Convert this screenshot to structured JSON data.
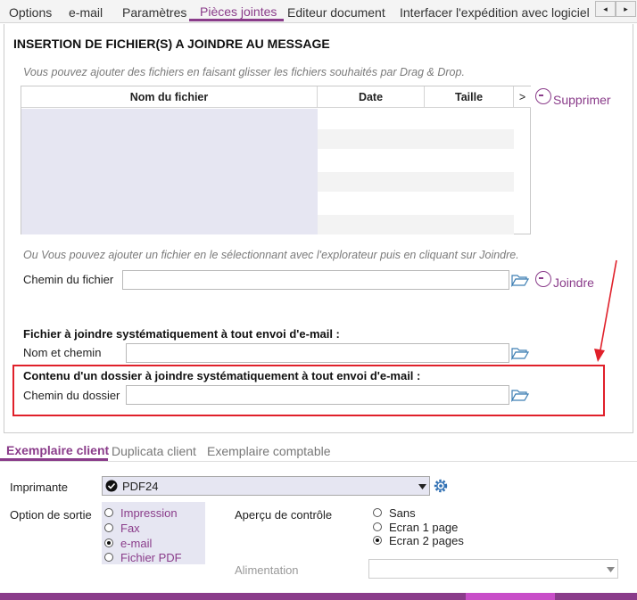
{
  "top_tabs": [
    {
      "label": "Options"
    },
    {
      "label": "e-mail"
    },
    {
      "label": "Paramètres"
    },
    {
      "label": "Pièces jointes"
    },
    {
      "label": "Editeur document"
    },
    {
      "label": "Interfacer l'expédition avec logiciel"
    }
  ],
  "nav": {
    "prev": "◂",
    "next": "▸"
  },
  "attachments": {
    "title": "INSERTION DE FICHIER(S) A JOINDRE AU MESSAGE",
    "drag_hint": "Vous pouvez ajouter des fichiers en faisant glisser les fichiers souhaités par Drag & Drop.",
    "table": {
      "columns": [
        "Nom du fichier",
        "Date",
        "Taille"
      ],
      "more": ">"
    },
    "delete_label": "Supprimer",
    "browse_hint": "Ou Vous pouvez ajouter un fichier en le sélectionnant avec l'explorateur puis en cliquant sur Joindre.",
    "file_path_label": "Chemin du fichier",
    "file_path_value": "",
    "attach_label": "Joindre"
  },
  "systematic": {
    "file_title": "Fichier à joindre systématiquement à tout envoi d'e-mail :",
    "name_path_label": "Nom et chemin",
    "name_path_value": "",
    "folder_title": "Contenu d'un dossier à joindre systématiquement à tout envoi d'e-mail :",
    "folder_path_label": "Chemin du dossier",
    "folder_path_value": ""
  },
  "bottom_tabs": [
    {
      "label": "Exemplaire client"
    },
    {
      "label": "Duplicata client"
    },
    {
      "label": "Exemplaire comptable"
    }
  ],
  "print": {
    "printer_label": "Imprimante",
    "printer_value": "PDF24",
    "output_label": "Option de sortie",
    "output_options": [
      {
        "label": "Impression",
        "selected": false
      },
      {
        "label": "Fax",
        "selected": false
      },
      {
        "label": "e-mail",
        "selected": true
      },
      {
        "label": "Fichier PDF",
        "selected": false
      }
    ],
    "preview_label": "Aperçu de contrôle",
    "preview_options": [
      {
        "label": "Sans",
        "selected": false
      },
      {
        "label": "Ecran 1 page",
        "selected": false
      },
      {
        "label": "Ecran 2 pages",
        "selected": true
      }
    ],
    "feed_label": "Alimentation",
    "feed_value": ""
  },
  "colors": {
    "accent": "#8a3c8a",
    "highlight": "#e0202a"
  }
}
